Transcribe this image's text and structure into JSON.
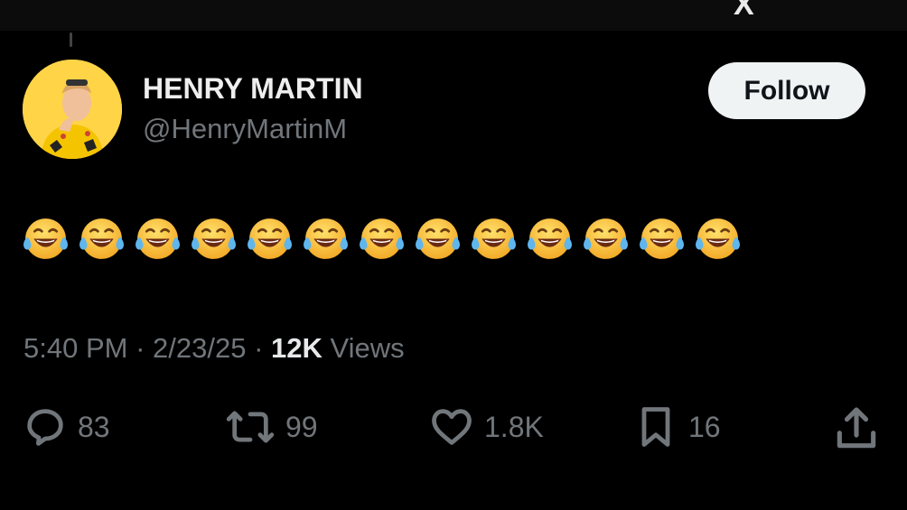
{
  "app": {
    "brand_glyph": "X"
  },
  "tweet": {
    "author": {
      "display_name": "HENRY MARTIN",
      "handle": "@HenryMartinM",
      "avatar_bg": "#ffd447"
    },
    "follow_label": "Follow",
    "text": "😂😂😂😂😂😂😂😂😂😂😂😂😂",
    "emoji_name": "face-with-tears-of-joy",
    "emoji_count": 13,
    "time": "5:40 PM",
    "sep1": " · ",
    "date": "2/23/25",
    "sep2": " · ",
    "views_count": "12K",
    "views_label": " Views"
  },
  "actions": {
    "replies": "83",
    "reposts": "99",
    "likes": "1.8K",
    "bookmarks": "16"
  }
}
